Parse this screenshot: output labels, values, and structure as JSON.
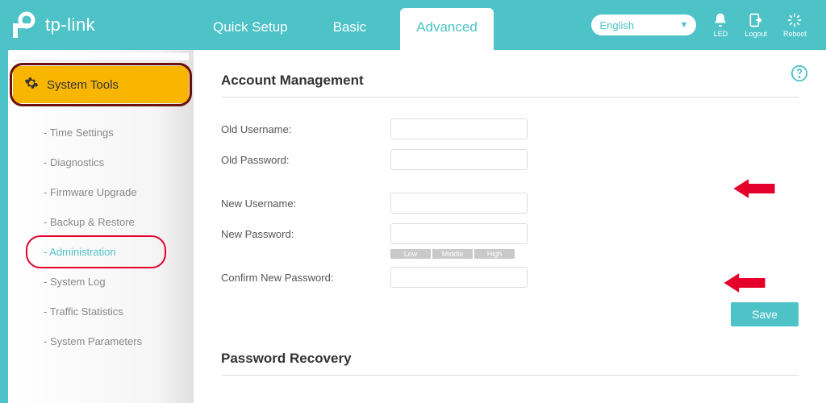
{
  "brand": "tp-link",
  "tabs": {
    "quick": "Quick Setup",
    "basic": "Basic",
    "advanced": "Advanced"
  },
  "lang": {
    "selected": "English"
  },
  "top_icons": {
    "led": "LED",
    "logout": "Logout",
    "reboot": "Reboot"
  },
  "sidebar": {
    "group": "System Tools",
    "items": [
      {
        "label": "Time Settings"
      },
      {
        "label": "Diagnostics"
      },
      {
        "label": "Firmware Upgrade"
      },
      {
        "label": "Backup & Restore"
      },
      {
        "label": "Administration"
      },
      {
        "label": "System Log"
      },
      {
        "label": "Traffic Statistics"
      },
      {
        "label": "System Parameters"
      }
    ]
  },
  "section": {
    "title": "Account Management",
    "old_user": "Old Username:",
    "old_pass": "Old Password:",
    "new_user": "New Username:",
    "new_pass": "New Password:",
    "confirm_pass": "Confirm New Password:",
    "strength": {
      "low": "Low",
      "mid": "Middle",
      "high": "High"
    },
    "save": "Save",
    "recovery": "Password Recovery"
  }
}
